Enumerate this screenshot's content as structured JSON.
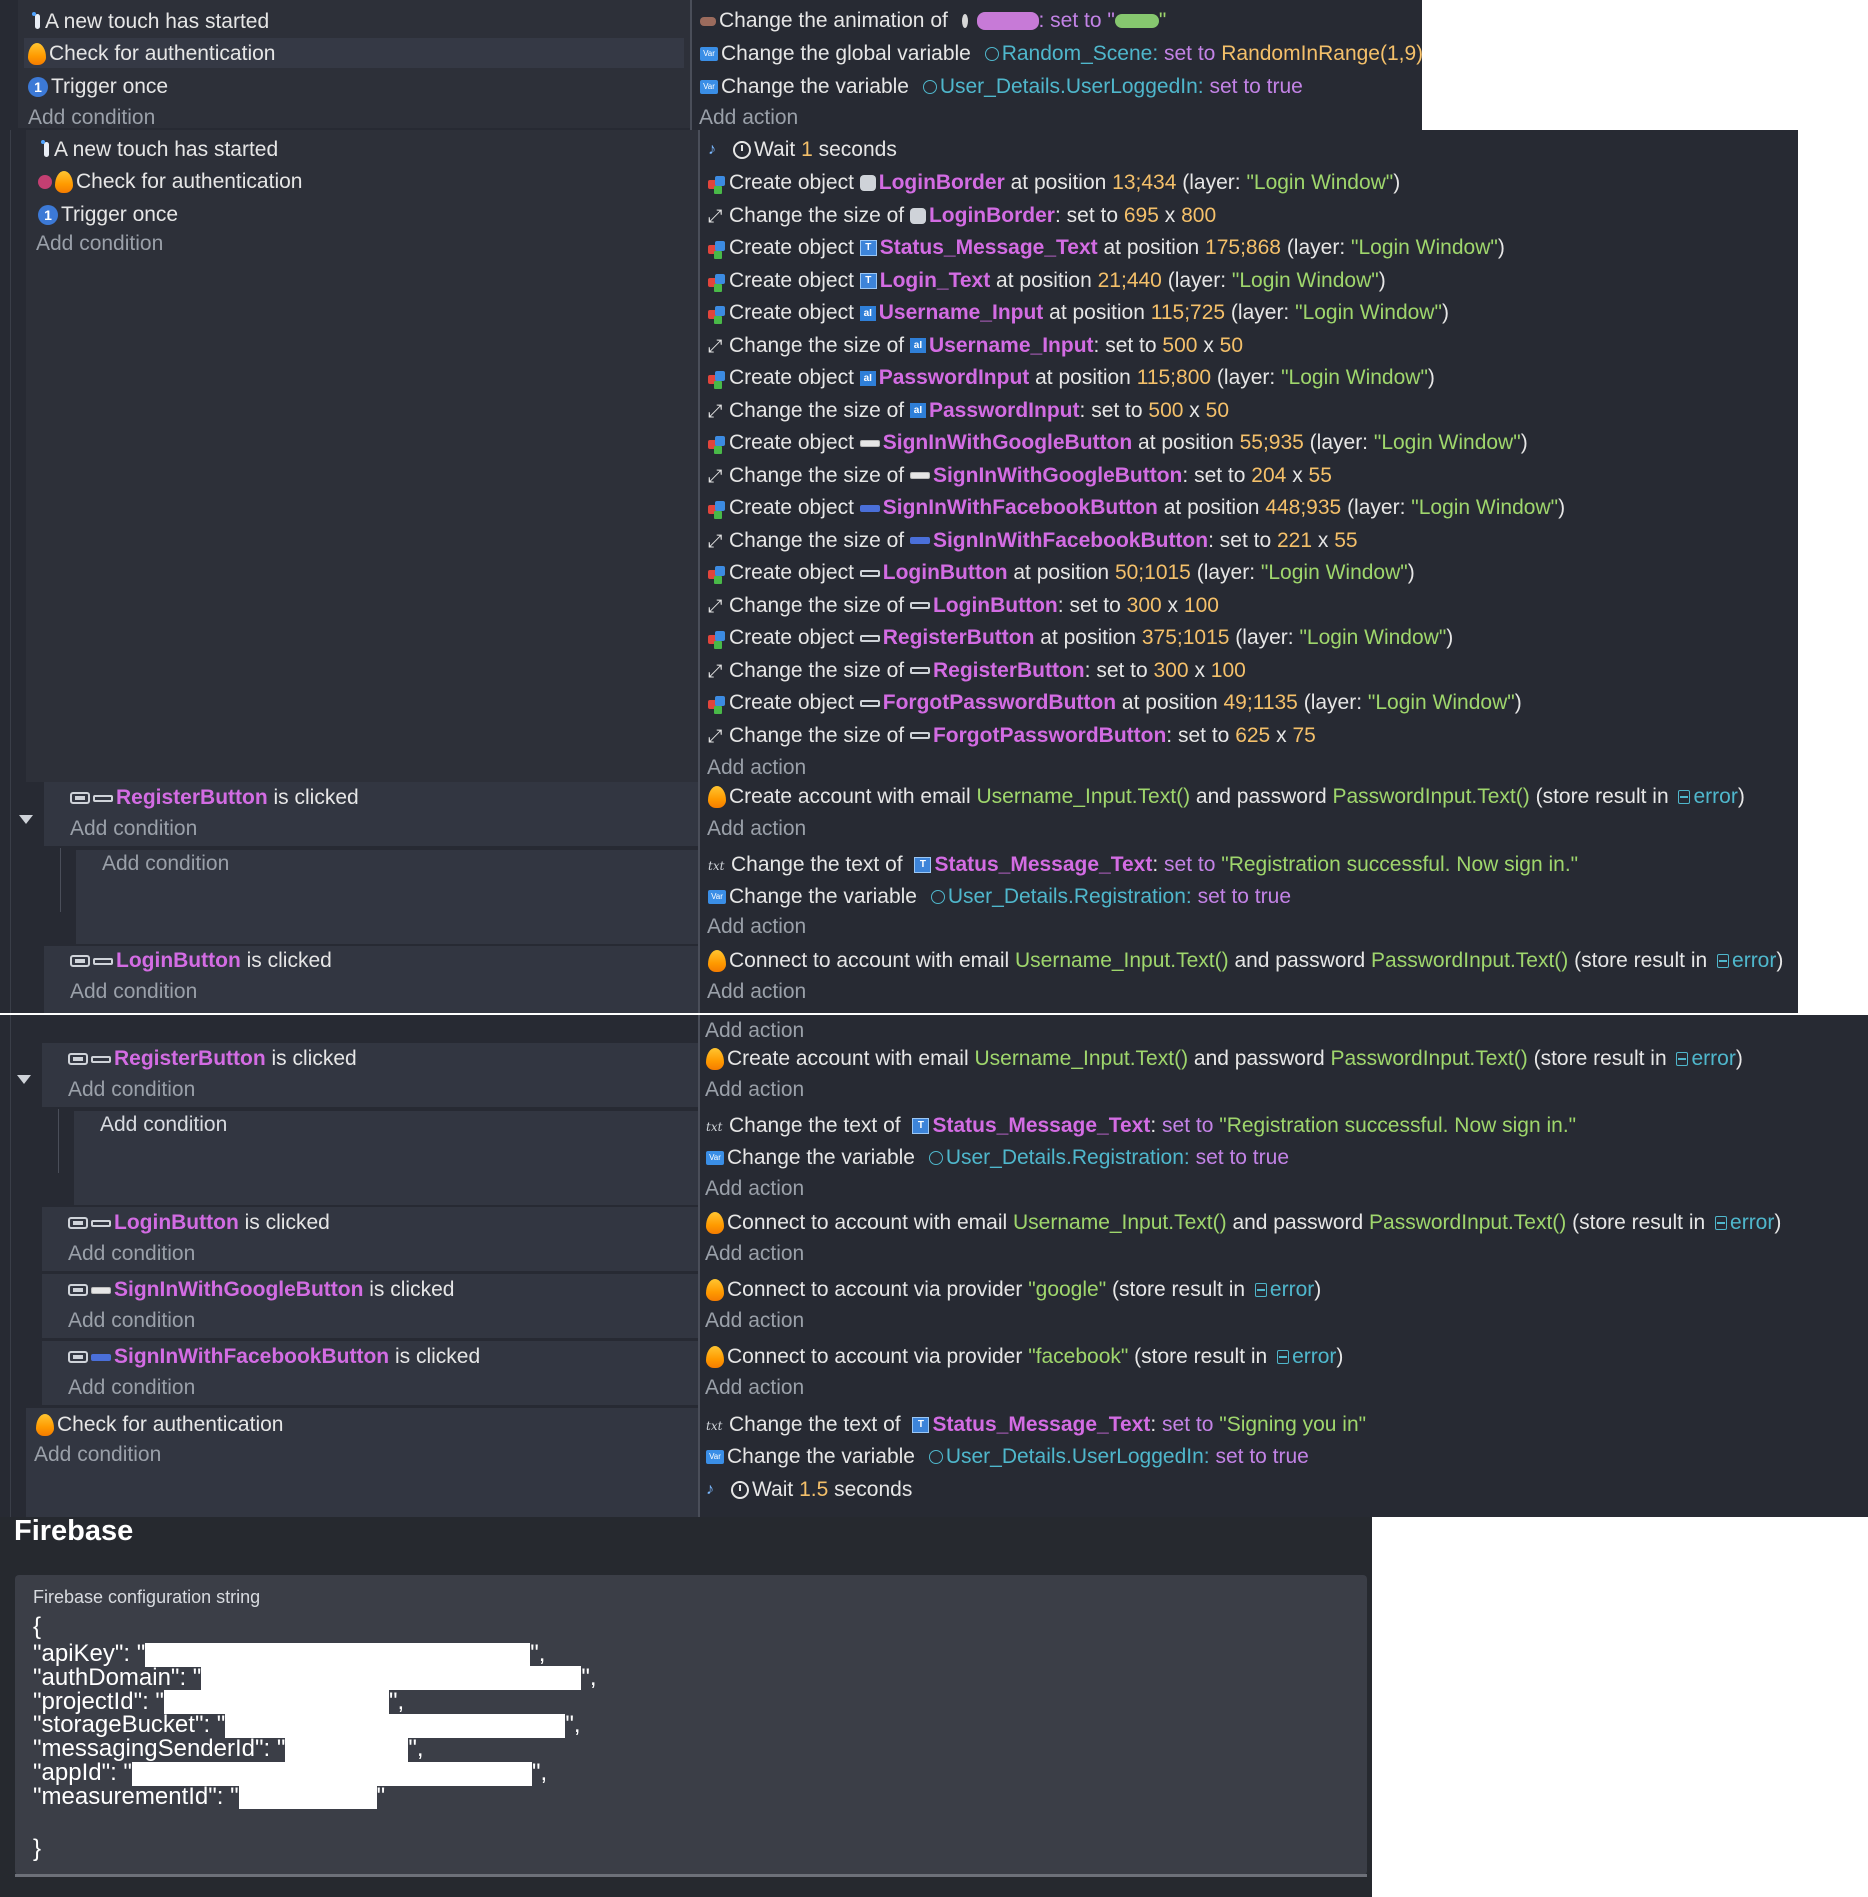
{
  "common": {
    "add_condition": "Add condition",
    "add_action": "Add action",
    "is_clicked": "is clicked",
    "create_object": "Create object",
    "at_position": "at position",
    "layer_open": "(layer: ",
    "layer_close": ")",
    "change_size_of": "Change the size of",
    "set_to": "set to",
    "x_sep": "x",
    "colon": ":",
    "wait": "Wait",
    "seconds": "seconds",
    "change_variable": "Change the variable",
    "change_text_of": "Change the text of",
    "store_open": "(store result in",
    "store_close": ")",
    "error_var": "error",
    "and_password": "and password",
    "create_account_email": "Create account with email",
    "connect_account_email": "Connect to account with email",
    "connect_provider": "Connect to account via provider",
    "username_expr": "Username_Input.Text()",
    "password_expr": "PasswordInput.Text()",
    "set_to_true": "set to true",
    "layer_name": "\"Login Window\""
  },
  "conditions": {
    "touch_started": "A new touch has started",
    "check_auth": "Check for authentication",
    "trigger_once": "Trigger once",
    "trigger_once_glyph": "1"
  },
  "event1": {
    "anim_prefix": "Change the animation of",
    "anim_suffix": ": set to \"",
    "anim_end": "\"",
    "global_var_label": "Change the global variable",
    "global_var_name": "Random_Scene",
    "global_var_set": "set to",
    "global_var_value": "RandomInRange(1,9)",
    "var_name": "User_Details.UserLoggedIn"
  },
  "event2": {
    "wait_value": "1",
    "creates": [
      {
        "obj": "LoginBorder",
        "pos": "13;434",
        "icon": "gear"
      },
      {
        "obj": "Status_Message_Text",
        "pos": "175;868",
        "icon": "text"
      },
      {
        "obj": "Login_Text",
        "pos": "21;440",
        "icon": "text"
      },
      {
        "obj": "Username_Input",
        "pos": "115;725",
        "icon": "input"
      },
      {
        "obj": "PasswordInput",
        "pos": "115;800",
        "icon": "input"
      },
      {
        "obj": "SignInWithGoogleButton",
        "pos": "55;935",
        "icon": "btn"
      },
      {
        "obj": "SignInWithFacebookButton",
        "pos": "448;935",
        "icon": "btn-fb"
      },
      {
        "obj": "LoginButton",
        "pos": "50;1015",
        "icon": "btn-hollow"
      },
      {
        "obj": "RegisterButton",
        "pos": "375;1015",
        "icon": "btn-hollow"
      },
      {
        "obj": "ForgotPasswordButton",
        "pos": "49;1135",
        "icon": "btn-hollow"
      }
    ],
    "sizes": {
      "LoginBorder": {
        "w": "695",
        "h": "800"
      },
      "Username_Input": {
        "w": "500",
        "h": "50"
      },
      "PasswordInput": {
        "w": "500",
        "h": "50"
      },
      "SignInWithGoogleButton": {
        "w": "204",
        "h": "55"
      },
      "SignInWithFacebookButton": {
        "w": "221",
        "h": "55"
      },
      "LoginButton": {
        "w": "300",
        "h": "100"
      },
      "RegisterButton": {
        "w": "300",
        "h": "100"
      },
      "ForgotPasswordButton": {
        "w": "625",
        "h": "75"
      }
    }
  },
  "objects": {
    "register_button": "RegisterButton",
    "login_button": "LoginButton",
    "google_button": "SignInWithGoogleButton",
    "facebook_button": "SignInWithFacebookButton",
    "status_text": "Status_Message_Text"
  },
  "subevents": {
    "registration_msg": "\"Registration successful. Now sign in.\"",
    "registration_var": "User_Details.Registration",
    "google_provider": "\"google\"",
    "facebook_provider": "\"facebook\"",
    "signing_msg": "\"Signing you in\"",
    "logged_in_var": "User_Details.UserLoggedIn",
    "wait_value2": "1.5"
  },
  "firebase": {
    "title": "Firebase",
    "config_label": "Firebase configuration string",
    "open_brace": "{",
    "close_brace": "}",
    "keys": [
      {
        "key": "\"apiKey\": \"",
        "end": "\","
      },
      {
        "key": "\"authDomain\": \"",
        "end": "\","
      },
      {
        "key": "\"projectId\": \"",
        "end": "\","
      },
      {
        "key": "\"storageBucket\": \"",
        "end": "\","
      },
      {
        "key": "\"messagingSenderId\": \"",
        "end": "\","
      },
      {
        "key": "\"appId\": \"",
        "end": "\","
      },
      {
        "key": "\"measurementId\": \"",
        "end": "\""
      }
    ]
  },
  "colors": {
    "panel_bg": "#272a33",
    "object_name": "#d36ce3",
    "number": "#f4c06a",
    "string": "#9fd66c",
    "variable": "#4fb7cc",
    "keyword": "#c383e6"
  }
}
